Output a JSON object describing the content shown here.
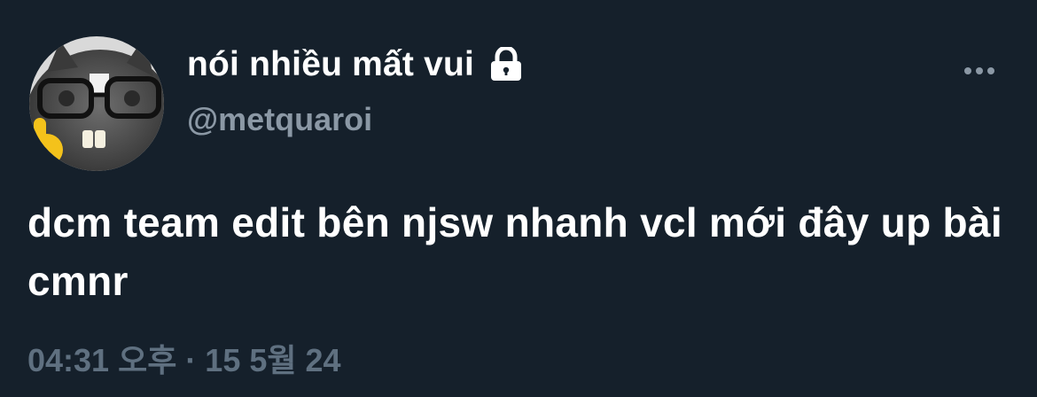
{
  "user": {
    "display_name": "nói nhiều mất vui",
    "handle": "@metquaroi",
    "avatar_icon": "cat-with-glasses-avatar",
    "protected_icon": "lock-icon"
  },
  "tweet": {
    "text": "dcm team edit bên njsw nhanh vcl mới đây up bài cmnr",
    "timestamp": "04:31 오후 · 15 5월 24"
  },
  "actions": {
    "more_icon": "more-options-icon"
  },
  "colors": {
    "background": "#15202b",
    "primary_text": "#ffffff",
    "secondary_text": "#8b98a5",
    "timestamp_text": "#5f7080"
  }
}
